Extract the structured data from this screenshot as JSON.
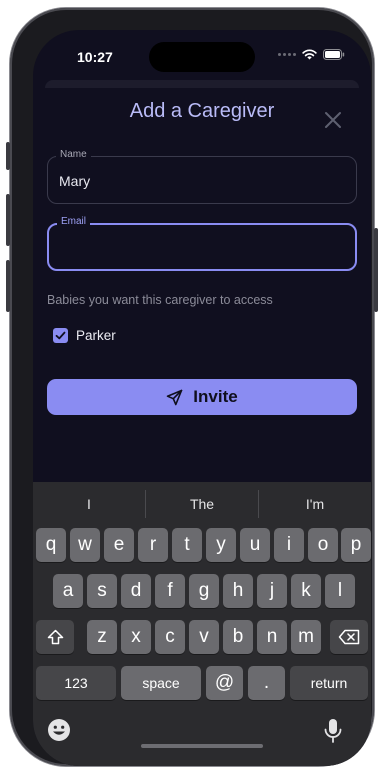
{
  "status": {
    "time": "10:27"
  },
  "form": {
    "title": "Add a Caregiver",
    "name_label": "Name",
    "name_value": "Mary",
    "email_label": "Email",
    "email_value": "",
    "babies_hint": "Babies you want this caregiver to access",
    "babies": [
      {
        "label": "Parker",
        "checked": true
      }
    ],
    "invite_label": "Invite"
  },
  "keyboard": {
    "suggestions": [
      "I",
      "The",
      "I'm"
    ],
    "row1": [
      "q",
      "w",
      "e",
      "r",
      "t",
      "y",
      "u",
      "i",
      "o",
      "p"
    ],
    "row2": [
      "a",
      "s",
      "d",
      "f",
      "g",
      "h",
      "j",
      "k",
      "l"
    ],
    "row3": [
      "z",
      "x",
      "c",
      "v",
      "b",
      "n",
      "m"
    ],
    "numbers_label": "123",
    "space_label": "space",
    "at_label": "@",
    "period_label": ".",
    "return_label": "return"
  },
  "colors": {
    "accent": "#8a8cf2",
    "background": "#100f1f",
    "title": "#b9bbf7"
  }
}
